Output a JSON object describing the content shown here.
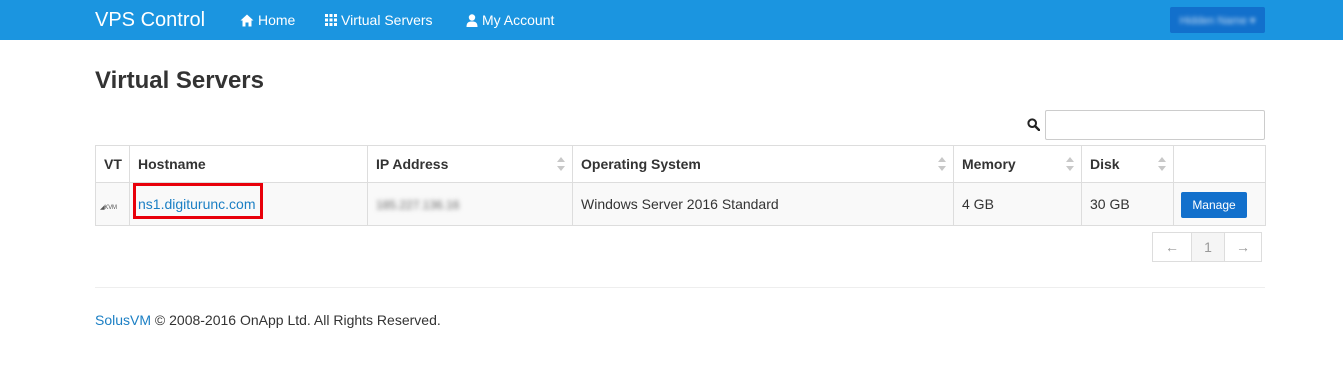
{
  "navbar": {
    "brand": "VPS Control",
    "items": [
      {
        "label": "Home",
        "icon": "home-icon"
      },
      {
        "label": "Virtual Servers",
        "icon": "grid-icon"
      },
      {
        "label": "My Account",
        "icon": "user-icon"
      }
    ],
    "user_menu_label": "Hidden Name ▾",
    "color": "#1b95e0"
  },
  "page": {
    "title": "Virtual Servers"
  },
  "search": {
    "value": "",
    "placeholder": ""
  },
  "table": {
    "columns": [
      "VT",
      "Hostname",
      "IP Address",
      "Operating System",
      "Memory",
      "Disk",
      ""
    ],
    "rows": [
      {
        "vt": "◢KVM",
        "hostname": "ns1.digiturunc.com",
        "ip": "185.227.136.16",
        "os": "Windows Server 2016 Standard",
        "memory": "4 GB",
        "disk": "30 GB",
        "action": "Manage"
      }
    ]
  },
  "pagination": {
    "prev": "←",
    "current": "1",
    "next": "→"
  },
  "footer": {
    "link": "SolusVM",
    "text": " © 2008-2016 OnApp Ltd. All Rights Reserved."
  },
  "colors": {
    "accent": "#1b95e0",
    "button": "#1270cc",
    "link": "#1b7fc4",
    "highlight": "#e8000a"
  }
}
